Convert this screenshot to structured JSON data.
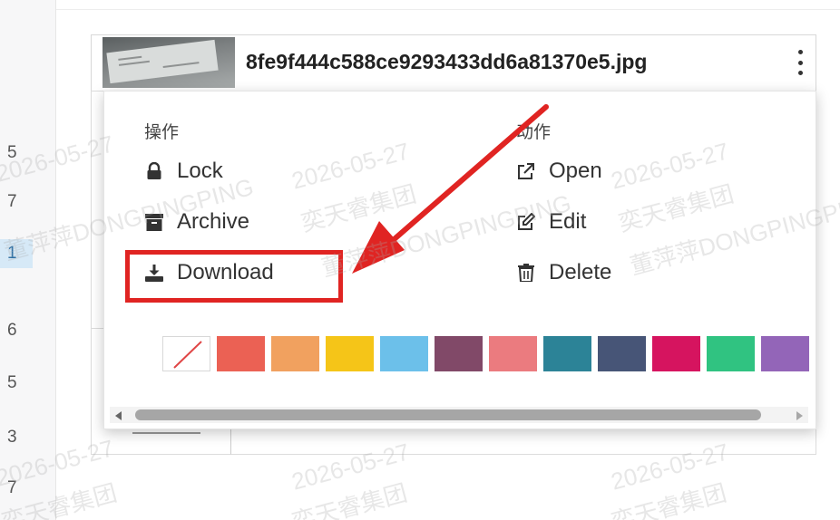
{
  "file": {
    "name": "8fe9f444c588ce9293433dd6a81370e5.jpg"
  },
  "row_numbers": [
    "5",
    "7",
    "1",
    "6",
    "5",
    "3",
    "7"
  ],
  "menu": {
    "section_left_title": "操作",
    "section_right_title": "动作",
    "left_items": [
      {
        "label": "Lock",
        "icon": "lock-icon"
      },
      {
        "label": "Archive",
        "icon": "archive-icon"
      },
      {
        "label": "Download",
        "icon": "download-icon"
      }
    ],
    "right_items": [
      {
        "label": "Open",
        "icon": "external-link-icon"
      },
      {
        "label": "Edit",
        "icon": "edit-icon"
      },
      {
        "label": "Delete",
        "icon": "trash-icon"
      }
    ],
    "colors": [
      "none",
      "#eb6154",
      "#f1a15f",
      "#f5c518",
      "#6cc0ea",
      "#814968",
      "#eb7b7f",
      "#2c8397",
      "#475577",
      "#d6145f",
      "#30c381",
      "#9365b8"
    ]
  },
  "watermark": {
    "date": "2026-05-27",
    "org": "奕天睿集团",
    "user": "董萍萍DONGPINGPING"
  },
  "annotation": {
    "highlight_color": "#e02422"
  }
}
